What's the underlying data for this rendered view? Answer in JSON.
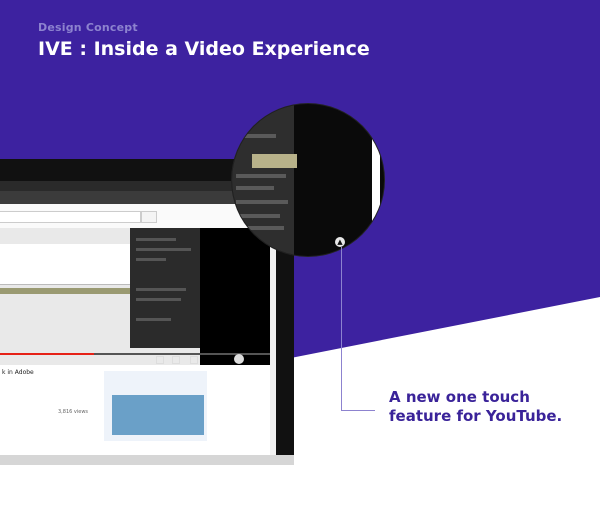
{
  "header": {
    "kicker": "Design Concept",
    "title": "IVE  : Inside a Video Experience"
  },
  "caption": {
    "line1": "A new one touch",
    "line2": "feature for YouTube."
  },
  "screen": {
    "video_title": "k in Adobe",
    "views": "3,816 views"
  },
  "colors": {
    "purple": "#3d22a0",
    "callout": "#3a2399",
    "accent_light": "#8d83cf",
    "progress_red": "#e62117"
  },
  "icons": [
    "touch-button-icon"
  ]
}
